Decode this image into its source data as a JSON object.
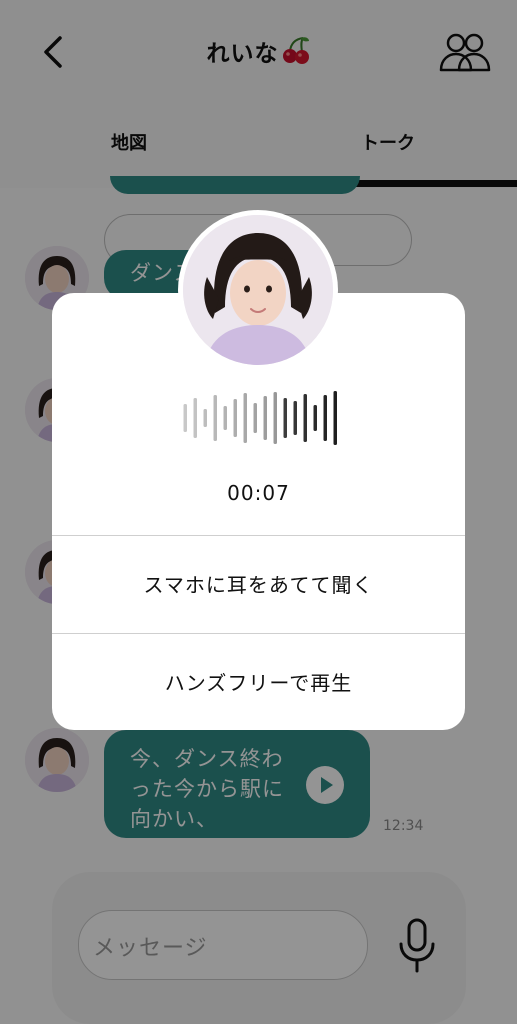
{
  "header": {
    "title": "れいな",
    "title_emoji": "cherry-icon"
  },
  "tabs": [
    {
      "label": "地図",
      "active": false
    },
    {
      "label": "トーク",
      "active": true
    }
  ],
  "messages": [
    {
      "text": "ダンス",
      "partially_hidden": true
    },
    {
      "text": "今、ダンス終わった今から駅に向かい、",
      "time": "12:34",
      "has_play_button": true
    }
  ],
  "visible_message_last": {
    "line1": "今、ダンス終わ",
    "line2": "った今から駅に",
    "line3": "向かい、",
    "time": "12:34"
  },
  "composer": {
    "placeholder": "メッセージ"
  },
  "modal": {
    "duration": "00:07",
    "option_earpiece": "スマホに耳をあてて聞く",
    "option_handsfree": "ハンズフリーで再生",
    "playback_progress": 0.35
  },
  "colors": {
    "bubble": "#2f8a86",
    "overlay": "rgba(0,0,0,0.42)",
    "tab_underline": "#111111"
  }
}
